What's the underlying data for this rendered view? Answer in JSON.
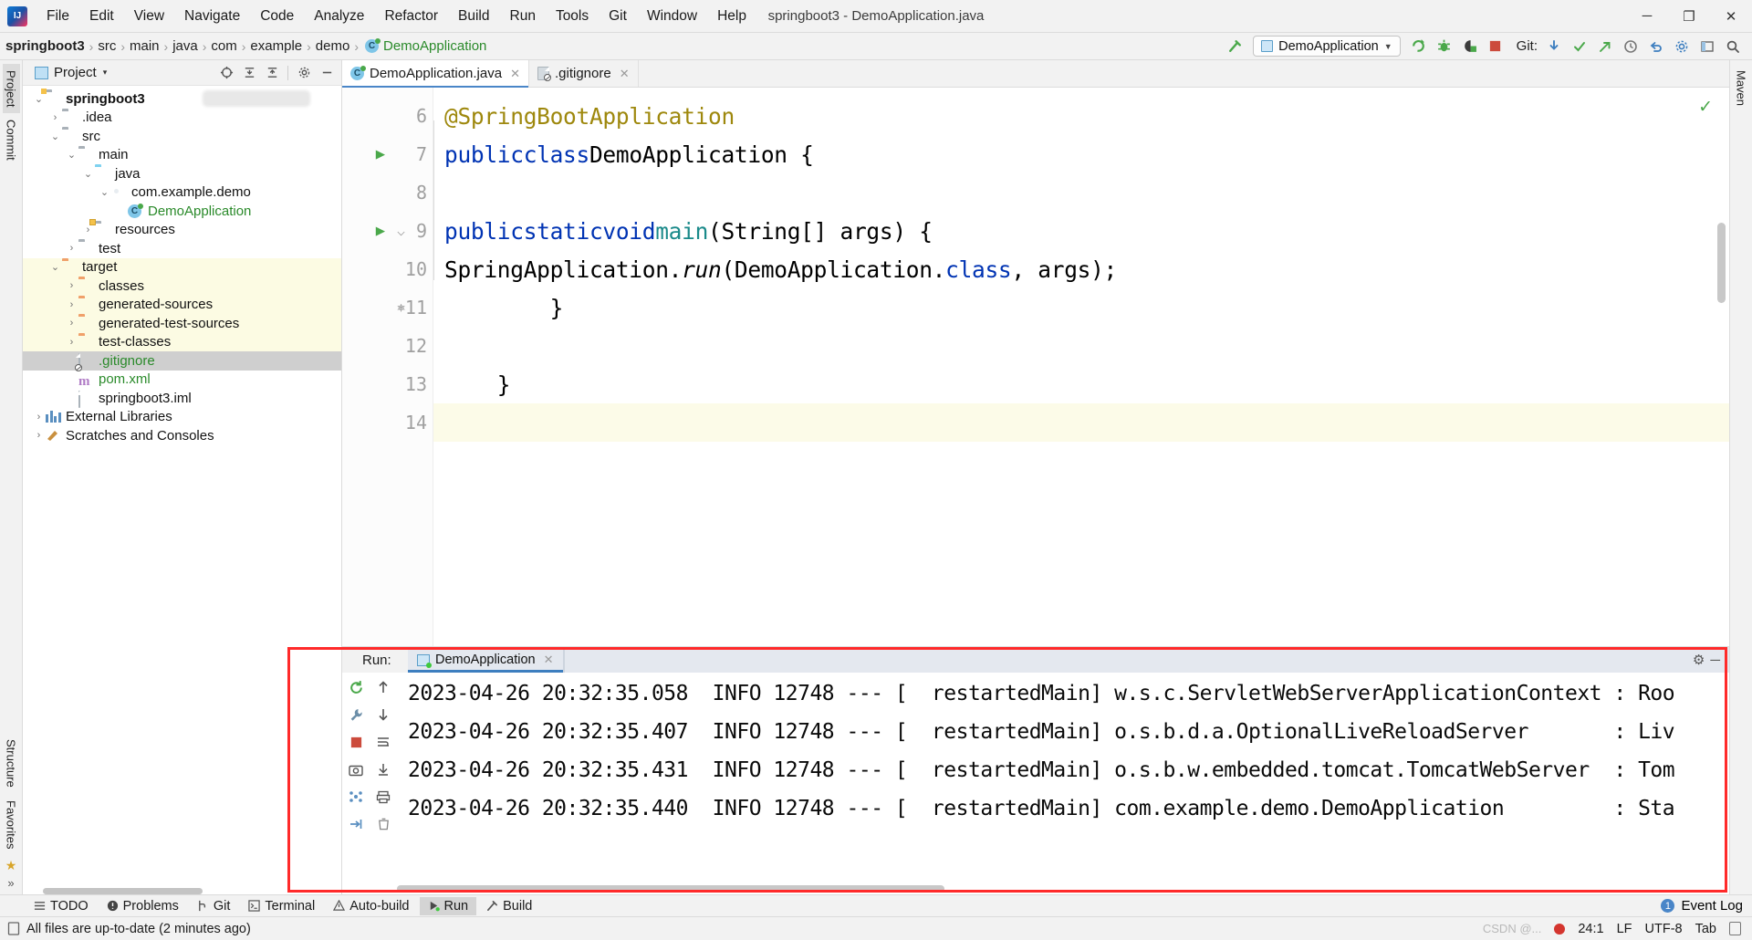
{
  "window": {
    "title": "springboot3 - DemoApplication.java",
    "app_logo": "intellij-idea-logo",
    "minimize": "─",
    "maximize": "❐",
    "close": "✕"
  },
  "menubar": {
    "items": [
      {
        "label": "File"
      },
      {
        "label": "Edit"
      },
      {
        "label": "View"
      },
      {
        "label": "Navigate"
      },
      {
        "label": "Code"
      },
      {
        "label": "Analyze"
      },
      {
        "label": "Refactor"
      },
      {
        "label": "Build"
      },
      {
        "label": "Run"
      },
      {
        "label": "Tools"
      },
      {
        "label": "Git"
      },
      {
        "label": "Window"
      },
      {
        "label": "Help"
      }
    ]
  },
  "breadcrumb": {
    "items": [
      {
        "label": "springboot3",
        "style": "bold"
      },
      {
        "label": "src",
        "style": "normal"
      },
      {
        "label": "main",
        "style": "normal"
      },
      {
        "label": "java",
        "style": "normal"
      },
      {
        "label": "com",
        "style": "normal"
      },
      {
        "label": "example",
        "style": "normal"
      },
      {
        "label": "demo",
        "style": "normal"
      },
      {
        "label": "DemoApplication",
        "style": "green"
      }
    ],
    "separator": "›"
  },
  "toolbar": {
    "build_icon": "hammer-icon",
    "run_config": {
      "label": "DemoApplication",
      "chevron": "▼"
    },
    "run_icon": "run-icon",
    "debug_icon": "debug-icon",
    "run_with_coverage_icon": "coverage-icon",
    "stop_icon": "stop-icon",
    "git_label": "Git:",
    "git_update_icon": "update-project-icon",
    "git_commit_icon": "commit-icon",
    "git_push_icon": "push-icon",
    "history_icon": "history-icon",
    "undo_icon": "undo-icon",
    "settings_icon": "settings-icon",
    "layout_icon": "layout-icon",
    "search_icon": "search-icon"
  },
  "left_strip": {
    "items": [
      {
        "label": "Project",
        "selected": true
      },
      {
        "label": "Commit",
        "selected": false
      }
    ],
    "bottom_items": [
      {
        "label": "Structure"
      },
      {
        "label": "Favorites"
      }
    ],
    "star_icon": "star-icon",
    "expand_icon": "»"
  },
  "right_strip": {
    "items": [
      {
        "label": "Maven"
      }
    ]
  },
  "project_panel": {
    "header": {
      "title": "Project",
      "chevron": "▾",
      "icon": "project-view-icon",
      "actions": [
        {
          "name": "select-opened-file-icon",
          "glyph": "⊕"
        },
        {
          "name": "expand-all-icon",
          "glyph": "⨅"
        },
        {
          "name": "collapse-all-icon",
          "glyph": "⨆"
        },
        {
          "name": "settings-gear-icon",
          "glyph": "⚙"
        },
        {
          "name": "hide-panel-icon",
          "glyph": "─"
        }
      ]
    },
    "tree": [
      {
        "label": "springboot3",
        "indent": 0,
        "arrow": "⌄",
        "icon": "module-folder",
        "style": "bold",
        "redacted": true
      },
      {
        "label": ".idea",
        "indent": 1,
        "arrow": "›",
        "icon": "folder-grey",
        "style": "normal"
      },
      {
        "label": "src",
        "indent": 1,
        "arrow": "⌄",
        "icon": "folder-grey",
        "style": "normal"
      },
      {
        "label": "main",
        "indent": 2,
        "arrow": "⌄",
        "icon": "folder-grey",
        "style": "normal"
      },
      {
        "label": "java",
        "indent": 3,
        "arrow": "⌄",
        "icon": "folder-source-blue",
        "style": "normal"
      },
      {
        "label": "com.example.demo",
        "indent": 4,
        "arrow": "⌄",
        "icon": "package",
        "style": "normal"
      },
      {
        "label": "DemoApplication",
        "indent": 5,
        "arrow": "",
        "icon": "java-class-runnable",
        "style": "green"
      },
      {
        "label": "resources",
        "indent": 4,
        "arrow": "›",
        "icon": "folder-resources",
        "style": "normal"
      },
      {
        "label": "test",
        "indent": 2,
        "arrow": "›",
        "icon": "folder-grey",
        "style": "normal"
      },
      {
        "label": "target",
        "indent": 1,
        "arrow": "⌄",
        "icon": "folder-orange",
        "style": "normal",
        "excluded": true
      },
      {
        "label": "classes",
        "indent": 2,
        "arrow": "›",
        "icon": "folder-orange",
        "style": "normal",
        "excluded": true
      },
      {
        "label": "generated-sources",
        "indent": 2,
        "arrow": "›",
        "icon": "folder-orange",
        "style": "normal",
        "excluded": true
      },
      {
        "label": "generated-test-sources",
        "indent": 2,
        "arrow": "›",
        "icon": "folder-orange",
        "style": "normal",
        "excluded": true
      },
      {
        "label": "test-classes",
        "indent": 2,
        "arrow": "›",
        "icon": "folder-orange",
        "style": "normal",
        "excluded": true
      },
      {
        "label": ".gitignore",
        "indent": 2,
        "arrow": "",
        "icon": "gitignore-file",
        "style": "green",
        "selected": true
      },
      {
        "label": "pom.xml",
        "indent": 2,
        "arrow": "",
        "icon": "maven-pom-file",
        "style": "normal"
      },
      {
        "label": "springboot3.iml",
        "indent": 2,
        "arrow": "",
        "icon": "iml-file",
        "style": "normal"
      },
      {
        "label": "External Libraries",
        "indent": 0,
        "arrow": "›",
        "icon": "libraries",
        "style": "normal"
      },
      {
        "label": "Scratches and Consoles",
        "indent": 0,
        "arrow": "›",
        "icon": "scratches",
        "style": "normal"
      }
    ]
  },
  "editor": {
    "tabs": [
      {
        "label": "DemoApplication.java",
        "icon": "java-class-icon",
        "active": true,
        "close": "✕"
      },
      {
        "label": ".gitignore",
        "icon": "gitignore-file-icon",
        "active": false,
        "close": "✕"
      }
    ],
    "inspection_ok_icon": "✓",
    "lines": [
      {
        "num": "6",
        "gutter_run": false,
        "gutter_fold": false,
        "highlight": false,
        "tokens": [
          {
            "t": "    ",
            "c": "plain"
          },
          {
            "t": "@SpringBootApplication",
            "c": "anno"
          }
        ]
      },
      {
        "num": "7",
        "gutter_run": true,
        "gutter_fold": false,
        "highlight": false,
        "tokens": [
          {
            "t": "    ",
            "c": "plain"
          },
          {
            "t": "public",
            "c": "kw"
          },
          {
            "t": " ",
            "c": "plain"
          },
          {
            "t": "class",
            "c": "kw"
          },
          {
            "t": " ",
            "c": "plain"
          },
          {
            "t": "DemoApplication",
            "c": "ident"
          },
          {
            "t": " {",
            "c": "plain"
          }
        ]
      },
      {
        "num": "8",
        "gutter_run": false,
        "gutter_fold": false,
        "highlight": false,
        "tokens": []
      },
      {
        "num": "9",
        "gutter_run": true,
        "gutter_fold": true,
        "highlight": false,
        "tokens": [
          {
            "t": "        ",
            "c": "plain"
          },
          {
            "t": "public",
            "c": "kw"
          },
          {
            "t": " ",
            "c": "plain"
          },
          {
            "t": "static",
            "c": "kw"
          },
          {
            "t": " ",
            "c": "plain"
          },
          {
            "t": "void",
            "c": "kw"
          },
          {
            "t": " ",
            "c": "plain"
          },
          {
            "t": "main",
            "c": "meth"
          },
          {
            "t": "(String[] args) {",
            "c": "plain"
          }
        ]
      },
      {
        "num": "10",
        "gutter_run": false,
        "gutter_fold": false,
        "highlight": false,
        "tokens": [
          {
            "t": "            ",
            "c": "plain"
          },
          {
            "t": "SpringApplication.",
            "c": "plain"
          },
          {
            "t": "run",
            "c": "ital"
          },
          {
            "t": "(DemoApplication.",
            "c": "plain"
          },
          {
            "t": "class",
            "c": "kw"
          },
          {
            "t": ", args);",
            "c": "plain"
          }
        ]
      },
      {
        "num": "11",
        "gutter_run": false,
        "gutter_fold": true,
        "highlight": false,
        "tokens": [
          {
            "t": "        }",
            "c": "plain"
          }
        ]
      },
      {
        "num": "12",
        "gutter_run": false,
        "gutter_fold": false,
        "highlight": false,
        "tokens": []
      },
      {
        "num": "13",
        "gutter_run": false,
        "gutter_fold": false,
        "highlight": false,
        "tokens": [
          {
            "t": "    }",
            "c": "plain"
          }
        ]
      },
      {
        "num": "14",
        "gutter_run": false,
        "gutter_fold": false,
        "highlight": true,
        "tokens": []
      }
    ]
  },
  "run_panel": {
    "label": "Run:",
    "tab": {
      "label": "DemoApplication",
      "close": "✕",
      "icon": "run-config-icon"
    },
    "tools": {
      "settings_icon": "⚙",
      "minimize_icon": "─"
    },
    "side_icons": [
      {
        "name": "rerun-icon",
        "glyph": "↺"
      },
      {
        "name": "scroll-up-icon",
        "glyph": "↑"
      },
      {
        "name": "wrench-icon",
        "glyph": "⚒"
      },
      {
        "name": "scroll-down-icon",
        "glyph": "↓"
      },
      {
        "name": "stop-icon",
        "glyph": "■"
      },
      {
        "name": "soft-wrap-icon",
        "glyph": "↵"
      },
      {
        "name": "camera-icon",
        "glyph": "▣"
      },
      {
        "name": "scroll-to-end-icon",
        "glyph": "↧"
      },
      {
        "name": "print-icon",
        "glyph": "⎙"
      },
      {
        "name": "thread-dump-icon",
        "glyph": "⁂"
      },
      {
        "name": "clear-all-icon",
        "glyph": "Ὕ1"
      },
      {
        "name": "export-icon",
        "glyph": "⇥"
      }
    ],
    "console_lines": [
      {
        "text": "2023-04-26 20:32:35.058  INFO 12748 --- [  restartedMain] w.s.c.ServletWebServerApplicationContext : Roo"
      },
      {
        "text": "2023-04-26 20:32:35.407  INFO 12748 --- [  restartedMain] o.s.b.d.a.OptionalLiveReloadServer       : Liv"
      },
      {
        "text": "2023-04-26 20:32:35.431  INFO 12748 --- [  restartedMain] o.s.b.w.embedded.tomcat.TomcatWebServer  : Tom"
      },
      {
        "text": "2023-04-26 20:32:35.440  INFO 12748 --- [  restartedMain] com.example.demo.DemoApplication         : Sta"
      }
    ]
  },
  "bottom_toolwindows": {
    "items": [
      {
        "label": "TODO",
        "icon": "todo-icon",
        "selected": false
      },
      {
        "label": "Problems",
        "icon": "problems-icon",
        "selected": false
      },
      {
        "label": "Git",
        "icon": "git-branch-icon",
        "selected": false
      },
      {
        "label": "Terminal",
        "icon": "terminal-icon",
        "selected": false
      },
      {
        "label": "Auto-build",
        "icon": "warning-icon",
        "selected": false
      },
      {
        "label": "Run",
        "icon": "run-icon",
        "selected": true
      },
      {
        "label": "Build",
        "icon": "build-hammer-icon",
        "selected": false
      }
    ],
    "event_log": {
      "label": "Event Log",
      "count": "1"
    }
  },
  "statusbar": {
    "message": "All files are up-to-date (2 minutes ago)",
    "message_icon": "file-sync-icon",
    "caret_position": "24:1",
    "line_separator": "LF",
    "encoding": "UTF-8",
    "indent": "Tab",
    "recording_icon": "recording-dot",
    "lock_icon": "read-only-lock-icon",
    "watermark": "CSDN @..."
  }
}
